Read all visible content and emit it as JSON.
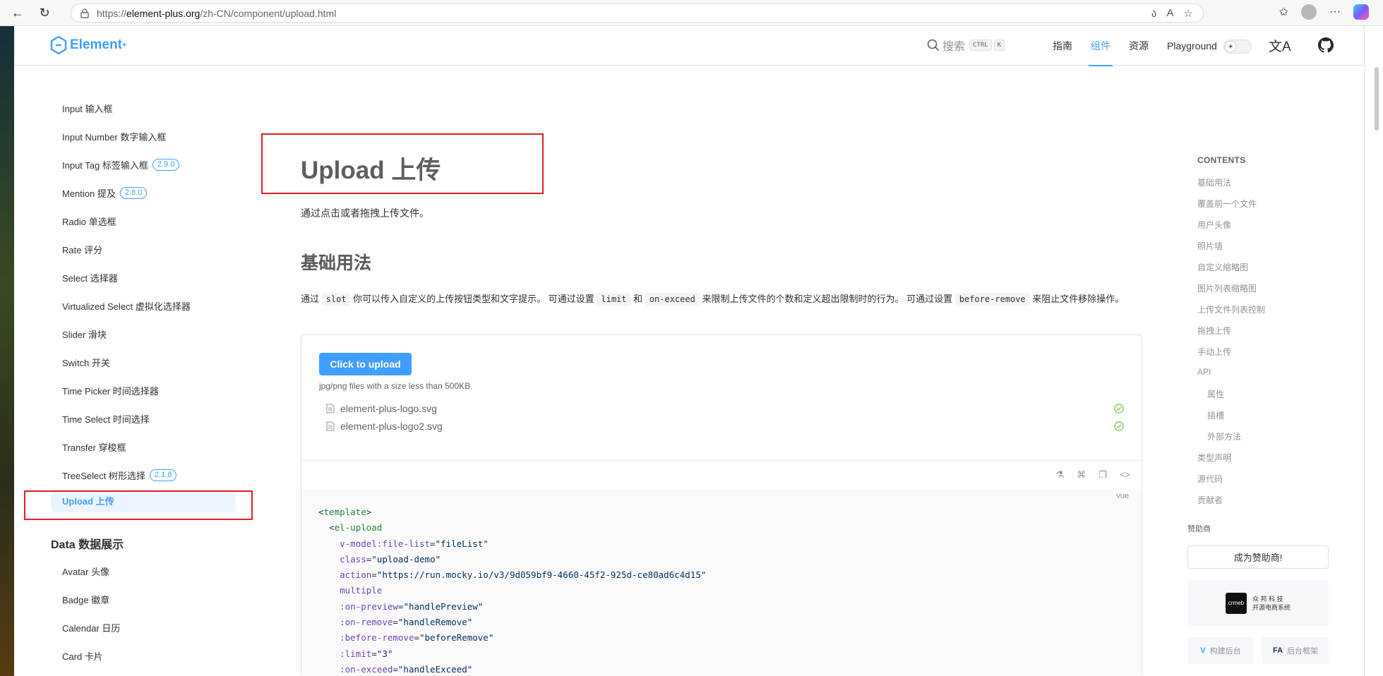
{
  "browser": {
    "url": "https://element-plus.org/zh-CN/component/upload.html",
    "url_display_host": "element-plus.org",
    "url_display_prefix": "https://",
    "url_display_path": "/zh-CN/component/upload.html"
  },
  "header": {
    "logo_text": "Element",
    "logo_sup": "+",
    "search_placeholder": "搜索",
    "search_kbd_ctrl": "CTRL",
    "search_kbd_k": "K",
    "nav": [
      "指南",
      "组件",
      "资源",
      "Playground"
    ],
    "active_nav": "组件"
  },
  "sidebar": {
    "items": [
      {
        "label": "Input 输入框"
      },
      {
        "label": "Input Number 数字输入框"
      },
      {
        "label": "Input Tag 标签输入框",
        "badge": "2.9.0"
      },
      {
        "label": "Mention 提及",
        "badge": "2.8.0"
      },
      {
        "label": "Radio 单选框"
      },
      {
        "label": "Rate 评分"
      },
      {
        "label": "Select 选择器"
      },
      {
        "label": "Virtualized Select 虚拟化选择器"
      },
      {
        "label": "Slider 滑块"
      },
      {
        "label": "Switch 开关"
      },
      {
        "label": "Time Picker 时间选择器"
      },
      {
        "label": "Time Select 时间选择"
      },
      {
        "label": "Transfer 穿梭框"
      },
      {
        "label": "TreeSelect 树形选择",
        "badge": "2.1.8"
      }
    ],
    "active_item": "Upload 上传",
    "group_title": "Data 数据展示",
    "group_items": [
      {
        "label": "Avatar 头像"
      },
      {
        "label": "Badge 徽章"
      },
      {
        "label": "Calendar 日历"
      },
      {
        "label": "Card 卡片"
      }
    ]
  },
  "main": {
    "title": "Upload 上传",
    "description": "通过点击或者拖拽上传文件。",
    "section_title": "基础用法",
    "section_desc_parts": {
      "p1": "通过",
      "c1": "slot",
      "p2": "你可以传入自定义的上传按钮类型和文字提示。 可通过设置",
      "c2": "limit",
      "p3": "和",
      "c3": "on-exceed",
      "p4": "来限制上传文件的个数和定义超出限制时的行为。 可通过设置",
      "c4": "before-remove",
      "p5": "来阻止文件移除操作。"
    },
    "demo": {
      "button_label": "Click to upload",
      "tip": "jpg/png files with a size less than 500KB.",
      "files": [
        "element-plus-logo.svg",
        "element-plus-logo2.svg"
      ],
      "code_lang": "vue"
    }
  },
  "toc": {
    "heading": "CONTENTS",
    "items": [
      {
        "label": "基础用法",
        "indent": false
      },
      {
        "label": "覆盖前一个文件",
        "indent": false
      },
      {
        "label": "用户头像",
        "indent": false
      },
      {
        "label": "照片墙",
        "indent": false
      },
      {
        "label": "自定义缩略图",
        "indent": false
      },
      {
        "label": "图片列表缩略图",
        "indent": false
      },
      {
        "label": "上传文件列表控制",
        "indent": false
      },
      {
        "label": "拖拽上传",
        "indent": false
      },
      {
        "label": "手动上传",
        "indent": false
      },
      {
        "label": "API",
        "indent": false
      },
      {
        "label": "属性",
        "indent": true
      },
      {
        "label": "插槽",
        "indent": true
      },
      {
        "label": "外部方法",
        "indent": true
      },
      {
        "label": "类型声明",
        "indent": false
      },
      {
        "label": "源代码",
        "indent": false
      },
      {
        "label": "贡献者",
        "indent": false
      }
    ],
    "sponsor_label": "赞助商",
    "sponsor_button": "成为赞助商!",
    "crmeb_logo": "crmeb",
    "crmeb_line1": "众 邦 科 技",
    "crmeb_line2": "开源电商系统",
    "mini1": "构建后台",
    "mini2": "后台框架"
  },
  "colors": {
    "accent": "#409eff",
    "annotation_red": "#e02020",
    "success": "#67c23a"
  }
}
